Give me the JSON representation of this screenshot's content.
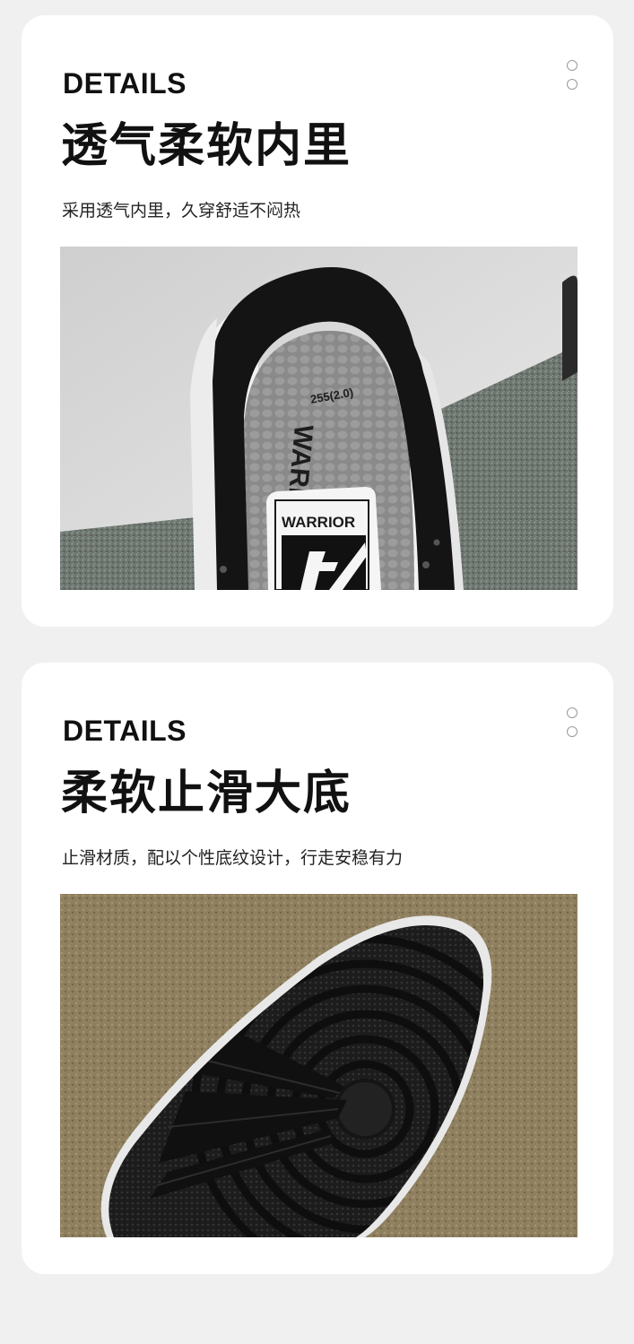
{
  "sections": [
    {
      "eyebrow": "DETAILS",
      "headline": "透气柔软内里",
      "subtext": "采用透气内里，久穿舒适不闷热",
      "photo": {
        "insole_size_mark": "255(2.0)",
        "insole_brand": "WARRIOR",
        "tongue_label": "WARRIOR"
      }
    },
    {
      "eyebrow": "DETAILS",
      "headline": "柔软止滑大底",
      "subtext": "止滑材质，配以个性底纹设计，行走安稳有力"
    }
  ],
  "colors": {
    "page_background": "#f0f0f0",
    "card_background": "#ffffff",
    "text": "#111111",
    "dot_outline": "#9a9a9a"
  },
  "icons": [
    "ellipsis-vertical-icon"
  ]
}
